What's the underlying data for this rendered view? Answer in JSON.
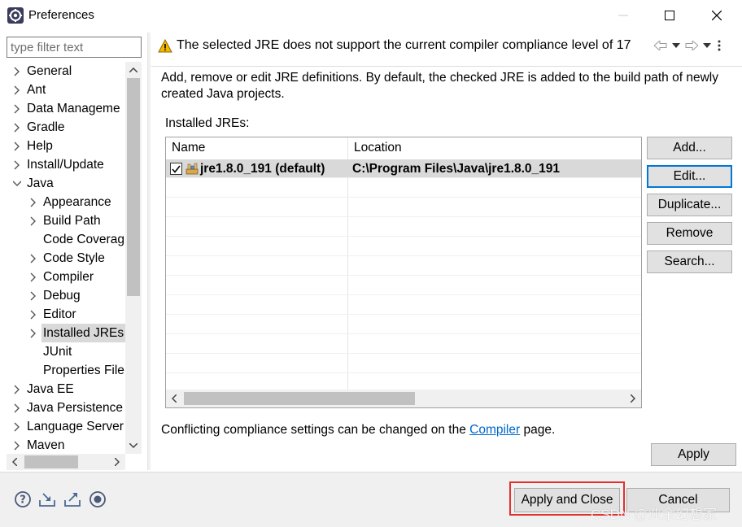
{
  "window": {
    "title": "Preferences"
  },
  "filter": {
    "placeholder": "type filter text"
  },
  "tree": [
    {
      "label": "General",
      "expanded": false,
      "has_children": true
    },
    {
      "label": "Ant",
      "expanded": false,
      "has_children": true
    },
    {
      "label": "Data Manageme",
      "expanded": false,
      "has_children": true
    },
    {
      "label": "Gradle",
      "expanded": false,
      "has_children": true
    },
    {
      "label": "Help",
      "expanded": false,
      "has_children": true
    },
    {
      "label": "Install/Update",
      "expanded": false,
      "has_children": true
    },
    {
      "label": "Java",
      "expanded": true,
      "has_children": true
    },
    {
      "label": "Appearance",
      "expanded": false,
      "has_children": true
    },
    {
      "label": "Build Path",
      "expanded": false,
      "has_children": true
    },
    {
      "label": "Code Coverag",
      "expanded": false,
      "has_children": false
    },
    {
      "label": "Code Style",
      "expanded": false,
      "has_children": true
    },
    {
      "label": "Compiler",
      "expanded": false,
      "has_children": true
    },
    {
      "label": "Debug",
      "expanded": false,
      "has_children": true
    },
    {
      "label": "Editor",
      "expanded": false,
      "has_children": true
    },
    {
      "label": "Installed JREs",
      "expanded": false,
      "has_children": true,
      "selected": true
    },
    {
      "label": "JUnit",
      "expanded": false,
      "has_children": false
    },
    {
      "label": "Properties File",
      "expanded": false,
      "has_children": false
    },
    {
      "label": "Java EE",
      "expanded": false,
      "has_children": true
    },
    {
      "label": "Java Persistence",
      "expanded": false,
      "has_children": true
    },
    {
      "label": "Language Server",
      "expanded": false,
      "has_children": true
    },
    {
      "label": "Maven",
      "expanded": false,
      "has_children": true
    }
  ],
  "message_bar": {
    "text": "The selected JRE does not support the current compiler compliance level of 17",
    "icon": "warning-icon"
  },
  "page": {
    "description": "Add, remove or edit JRE definitions. By default, the checked JRE is added to the build path of newly created Java projects.",
    "installed_label": "Installed JREs:",
    "table": {
      "columns": [
        "Name",
        "Location"
      ],
      "rows": [
        {
          "name": "jre1.8.0_191 (default)",
          "location": "C:\\Program Files\\Java\\jre1.8.0_191",
          "checked": true
        }
      ]
    },
    "buttons": {
      "add": "Add...",
      "edit": "Edit...",
      "duplicate": "Duplicate...",
      "remove": "Remove",
      "search": "Search..."
    },
    "conflict_before": "Conflicting compliance settings can be changed on the ",
    "conflict_link": "Compiler",
    "conflict_after": " page.",
    "apply": "Apply"
  },
  "footer": {
    "apply_close": "Apply and Close",
    "cancel": "Cancel",
    "icons": [
      "help-icon",
      "import-icon",
      "export-icon",
      "record-icon"
    ]
  },
  "watermark": "CSDN @业余幻想家",
  "colors": {
    "selection": "#d9d9d9",
    "focus_border": "#0078d7",
    "link": "#0066cc",
    "highlight_box": "#e03030",
    "warning": "#f5b800"
  }
}
